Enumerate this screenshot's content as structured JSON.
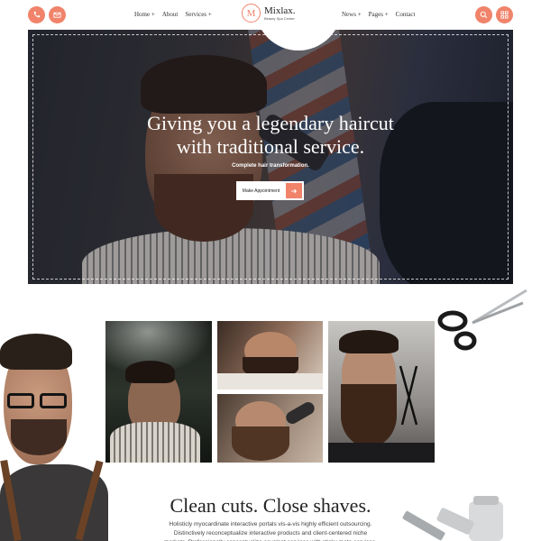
{
  "header": {
    "nav_left": [
      {
        "label": "Home +"
      },
      {
        "label": "About"
      },
      {
        "label": "Services +"
      }
    ],
    "nav_right": [
      {
        "label": "News +"
      },
      {
        "label": "Pages +"
      },
      {
        "label": "Contact"
      }
    ],
    "logo": {
      "mark": "M",
      "name": "Mixlax.",
      "tagline": "Beauty Spa Center"
    },
    "icons": [
      "phone-icon",
      "mail-icon",
      "search-icon",
      "menu-icon"
    ],
    "accent": "#f0836a"
  },
  "hero": {
    "title_line1": "Giving you a legendary haircut",
    "title_line2": "with traditional service.",
    "subtitle": "Complete hair transformation.",
    "button_label": "Make Appointment"
  },
  "about": {
    "heading": "Clean cuts. Close shaves.",
    "paragraph": "Holisticly myocardinate interactive portals vis-a-vis highly efficient outsourcing. Distinctively reconceptualize interactive products and client-centered niche markets. Professionally conceptualize covalent services with sticky meta-services."
  }
}
